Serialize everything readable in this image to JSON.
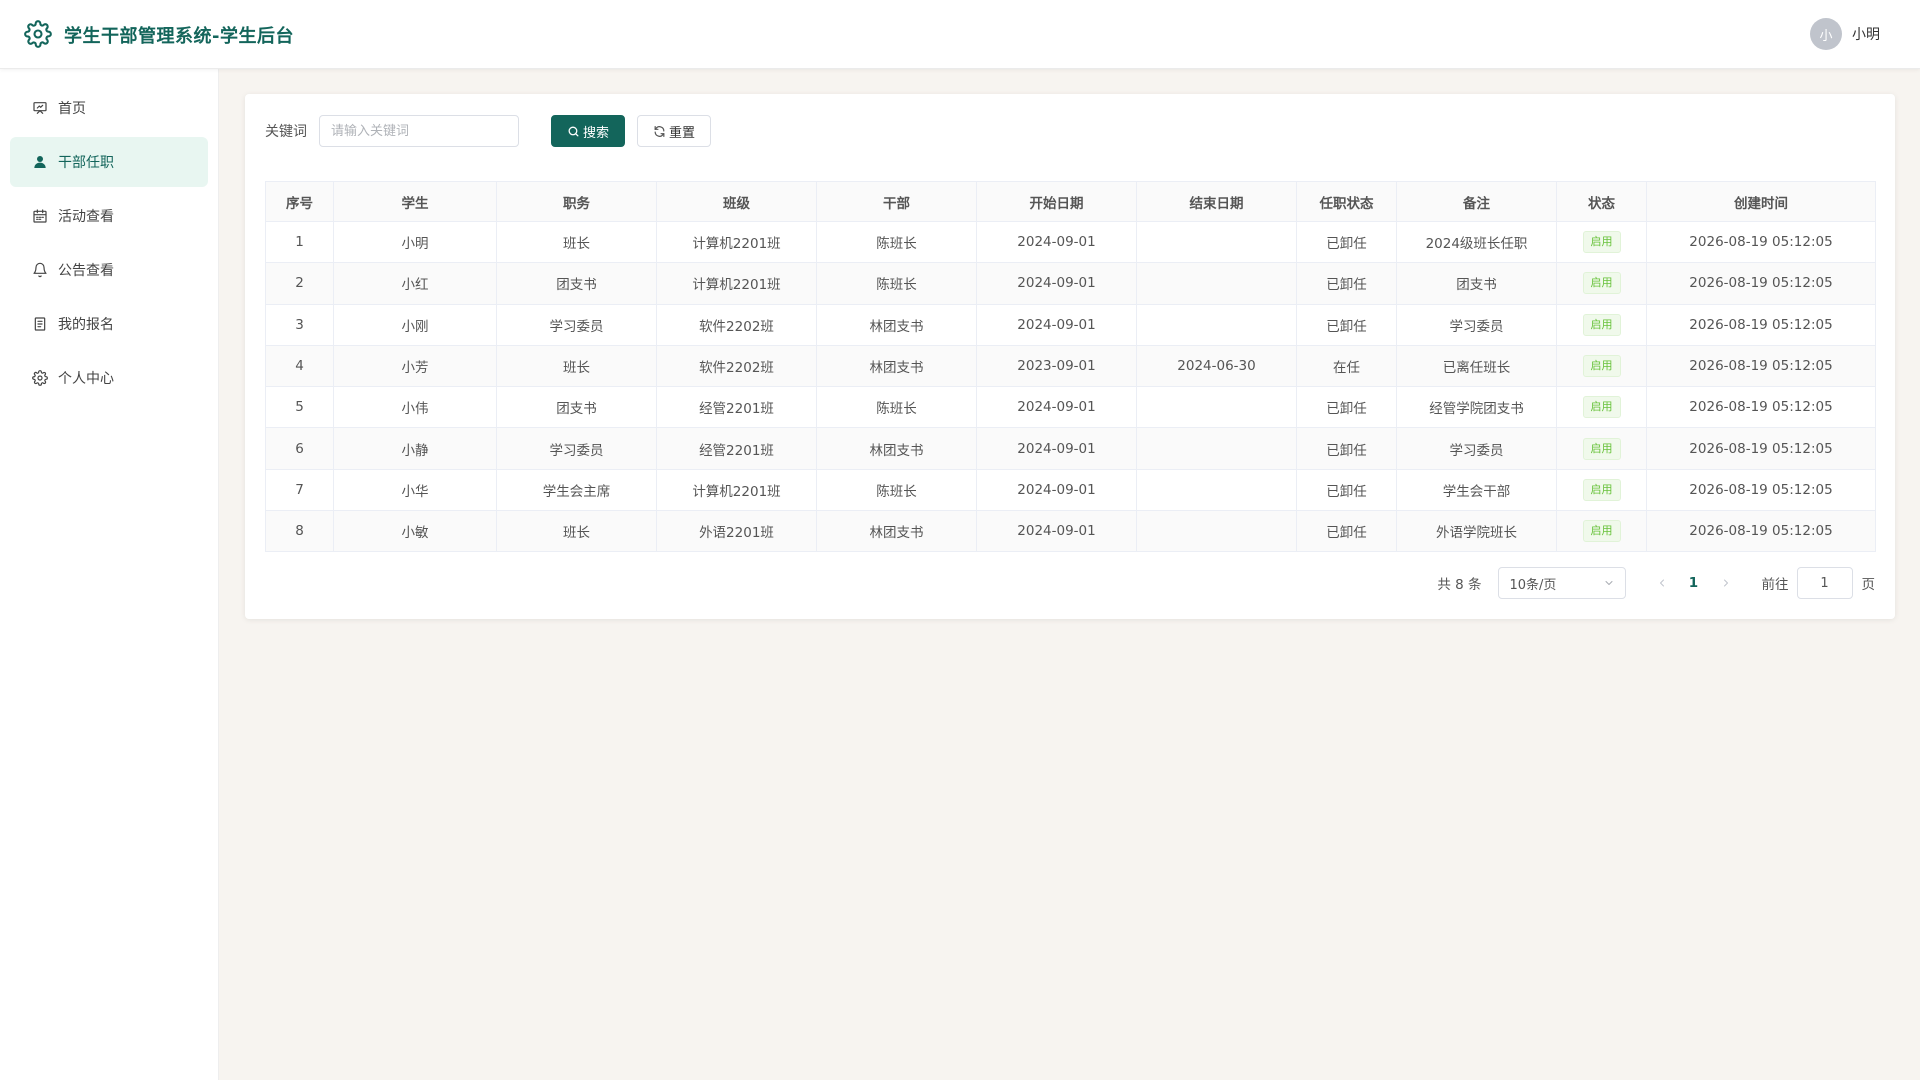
{
  "app": {
    "title": "学生干部管理系统-学生后台",
    "brand_color": "#13655b"
  },
  "user": {
    "avatar_text": "小",
    "name": "小明"
  },
  "sidebar": {
    "items": [
      {
        "label": "首页",
        "icon": "presentation-icon"
      },
      {
        "label": "干部任职",
        "icon": "user-icon",
        "active": true
      },
      {
        "label": "活动查看",
        "icon": "calendar-icon"
      },
      {
        "label": "公告查看",
        "icon": "bell-icon"
      },
      {
        "label": "我的报名",
        "icon": "document-icon"
      },
      {
        "label": "个人中心",
        "icon": "gear-icon"
      }
    ]
  },
  "search": {
    "label": "关键词",
    "placeholder": "请输入关键词",
    "value": "",
    "search_button": "搜索",
    "reset_button": "重置"
  },
  "table": {
    "headers": [
      "序号",
      "学生",
      "职务",
      "班级",
      "干部",
      "开始日期",
      "结束日期",
      "任职状态",
      "备注",
      "状态",
      "创建时间"
    ],
    "rows": [
      [
        "1",
        "小明",
        "班长",
        "计算机2201班",
        "陈班长",
        "2024-09-01",
        "",
        "已卸任",
        "2024级班长任职",
        "启用",
        "2026-08-19 05:12:05"
      ],
      [
        "2",
        "小红",
        "团支书",
        "计算机2201班",
        "陈班长",
        "2024-09-01",
        "",
        "已卸任",
        "团支书",
        "启用",
        "2026-08-19 05:12:05"
      ],
      [
        "3",
        "小刚",
        "学习委员",
        "软件2202班",
        "林团支书",
        "2024-09-01",
        "",
        "已卸任",
        "学习委员",
        "启用",
        "2026-08-19 05:12:05"
      ],
      [
        "4",
        "小芳",
        "班长",
        "软件2202班",
        "林团支书",
        "2023-09-01",
        "2024-06-30",
        "在任",
        "已离任班长",
        "启用",
        "2026-08-19 05:12:05"
      ],
      [
        "5",
        "小伟",
        "团支书",
        "经管2201班",
        "陈班长",
        "2024-09-01",
        "",
        "已卸任",
        "经管学院团支书",
        "启用",
        "2026-08-19 05:12:05"
      ],
      [
        "6",
        "小静",
        "学习委员",
        "经管2201班",
        "林团支书",
        "2024-09-01",
        "",
        "已卸任",
        "学习委员",
        "启用",
        "2026-08-19 05:12:05"
      ],
      [
        "7",
        "小华",
        "学生会主席",
        "计算机2201班",
        "陈班长",
        "2024-09-01",
        "",
        "已卸任",
        "学生会干部",
        "启用",
        "2026-08-19 05:12:05"
      ],
      [
        "8",
        "小敏",
        "班长",
        "外语2201班",
        "林团支书",
        "2024-09-01",
        "",
        "已卸任",
        "外语学院班长",
        "启用",
        "2026-08-19 05:12:05"
      ]
    ]
  },
  "pagination": {
    "total_text": "共 8 条",
    "page_size": "10条/页",
    "current_page": "1",
    "goto_label": "前往",
    "goto_value": "1",
    "page_suffix": "页"
  }
}
